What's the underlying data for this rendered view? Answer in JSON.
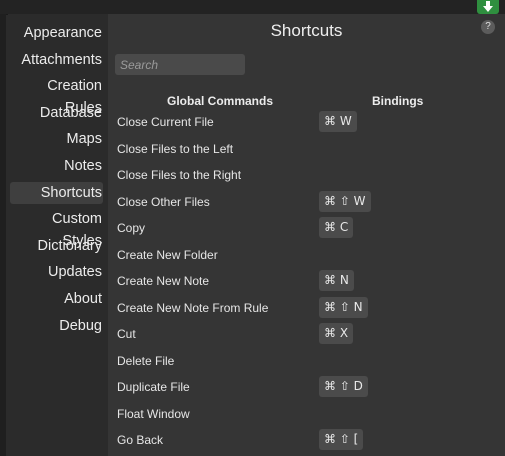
{
  "sidebar": {
    "items": [
      {
        "label": "Appearance"
      },
      {
        "label": "Attachments"
      },
      {
        "label": "Creation Rules"
      },
      {
        "label": "Database"
      },
      {
        "label": "Maps"
      },
      {
        "label": "Notes"
      },
      {
        "label": "Shortcuts"
      },
      {
        "label": "Custom Styles"
      },
      {
        "label": "Dictionary"
      },
      {
        "label": "Updates"
      },
      {
        "label": "About"
      },
      {
        "label": "Debug"
      }
    ],
    "active": "Shortcuts"
  },
  "main": {
    "title": "Shortcuts",
    "help_label": "?",
    "search_placeholder": "Search",
    "col_commands": "Global Commands",
    "col_bindings": "Bindings"
  },
  "commands": [
    {
      "name": "Close Current File",
      "binding": "⌘ W"
    },
    {
      "name": "Close Files to the Left",
      "binding": ""
    },
    {
      "name": "Close Files to the Right",
      "binding": ""
    },
    {
      "name": "Close Other Files",
      "binding": "⌘ ⇧ W"
    },
    {
      "name": "Copy",
      "binding": "⌘ C"
    },
    {
      "name": "Create New Folder",
      "binding": ""
    },
    {
      "name": "Create New Note",
      "binding": "⌘ N"
    },
    {
      "name": "Create New Note From Rule",
      "binding": "⌘ ⇧ N"
    },
    {
      "name": "Cut",
      "binding": "⌘ X"
    },
    {
      "name": "Delete File",
      "binding": ""
    },
    {
      "name": "Duplicate File",
      "binding": "⌘ ⇧ D"
    },
    {
      "name": "Float Window",
      "binding": ""
    },
    {
      "name": "Go Back",
      "binding": "⌘ ⇧ ["
    }
  ],
  "colors": {
    "download_accent": "#2f8f3f",
    "active_item_bg": "#3f3f3f",
    "key_bg": "#4b4b4b"
  },
  "icons": {
    "download": "download-arrow-icon",
    "help": "help-icon"
  }
}
